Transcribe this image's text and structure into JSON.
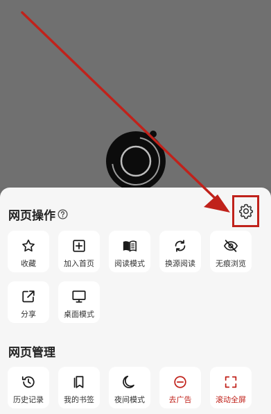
{
  "sections": {
    "page_ops_title": "网页操作",
    "page_mgmt_title": "网页管理"
  },
  "page_ops": [
    {
      "label": "收藏",
      "icon": "star-icon"
    },
    {
      "label": "加入首页",
      "icon": "add-square-icon"
    },
    {
      "label": "阅读模式",
      "icon": "book-icon"
    },
    {
      "label": "换源阅读",
      "icon": "refresh-icon"
    },
    {
      "label": "无痕浏览",
      "icon": "eye-off-icon"
    },
    {
      "label": "分享",
      "icon": "share-icon"
    },
    {
      "label": "桌面模式",
      "icon": "monitor-icon"
    }
  ],
  "page_mgmt": [
    {
      "label": "历史记录",
      "icon": "history-icon"
    },
    {
      "label": "我的书签",
      "icon": "bookmark-icon"
    },
    {
      "label": "夜间模式",
      "icon": "moon-icon"
    },
    {
      "label": "去广告",
      "icon": "minus-circle-icon"
    },
    {
      "label": "滚动全屏",
      "icon": "fullscreen-icon"
    }
  ],
  "colors": {
    "accent_red": "#c0221b",
    "annotation_red": "#c0221b",
    "icon": "#1a1a1a"
  }
}
